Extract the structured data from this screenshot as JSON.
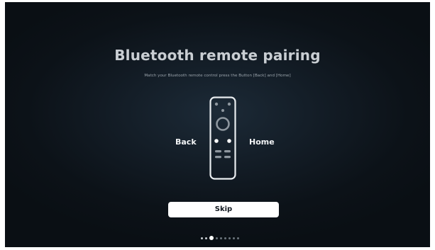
{
  "screen": {
    "title": "Bluetooth remote pairing",
    "instruction": "Match your Bluetooth remote control press the Button [Back] and [Home]"
  },
  "remote": {
    "left_label": "Back",
    "right_label": "Home"
  },
  "actions": {
    "skip_label": "Skip"
  },
  "pager": {
    "total_steps": 9,
    "current_step": 3
  },
  "colors": {
    "background": "#0f161d",
    "title": "#c9ced3",
    "button_background": "#ffffff",
    "button_text": "#111820"
  }
}
